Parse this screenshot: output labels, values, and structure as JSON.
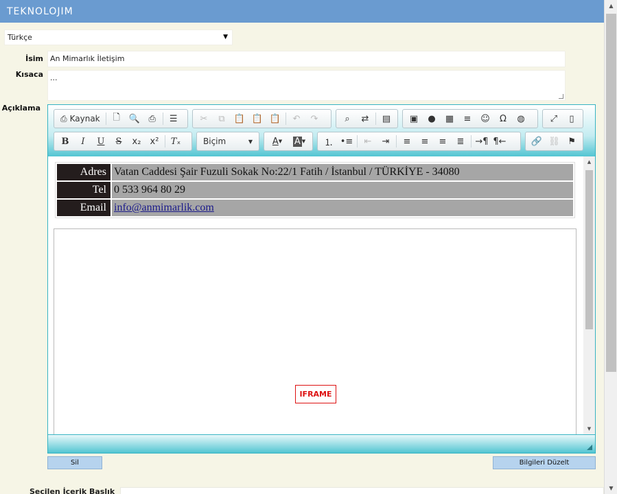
{
  "header": {
    "logo": "TEKNOLOJIM"
  },
  "language_select": {
    "value": "Türkçe"
  },
  "form": {
    "name_label": "İsim",
    "name_value": "An Mimarlık İletişim",
    "short_label": "Kısaca",
    "short_value": "...",
    "desc_label": "Açıklama"
  },
  "toolbar": {
    "source_label": "Kaynak",
    "format_label": "Biçim"
  },
  "content_table": {
    "rows": [
      {
        "key": "Adres",
        "value": "Vatan Caddesi Şair Fuzuli Sokak No:22/1  Fatih / İstanbul / TÜRKİYE - 34080"
      },
      {
        "key": "Tel",
        "value": "0 533 964 80 29"
      },
      {
        "key": "Email",
        "value": "info@anmimarlik.com"
      }
    ]
  },
  "iframe_placeholder": "IFRAME",
  "buttons": {
    "delete": "Sil",
    "update": "Bilgileri Düzelt"
  },
  "footer_section": {
    "label": "Seçilen İçerik Başlık"
  }
}
